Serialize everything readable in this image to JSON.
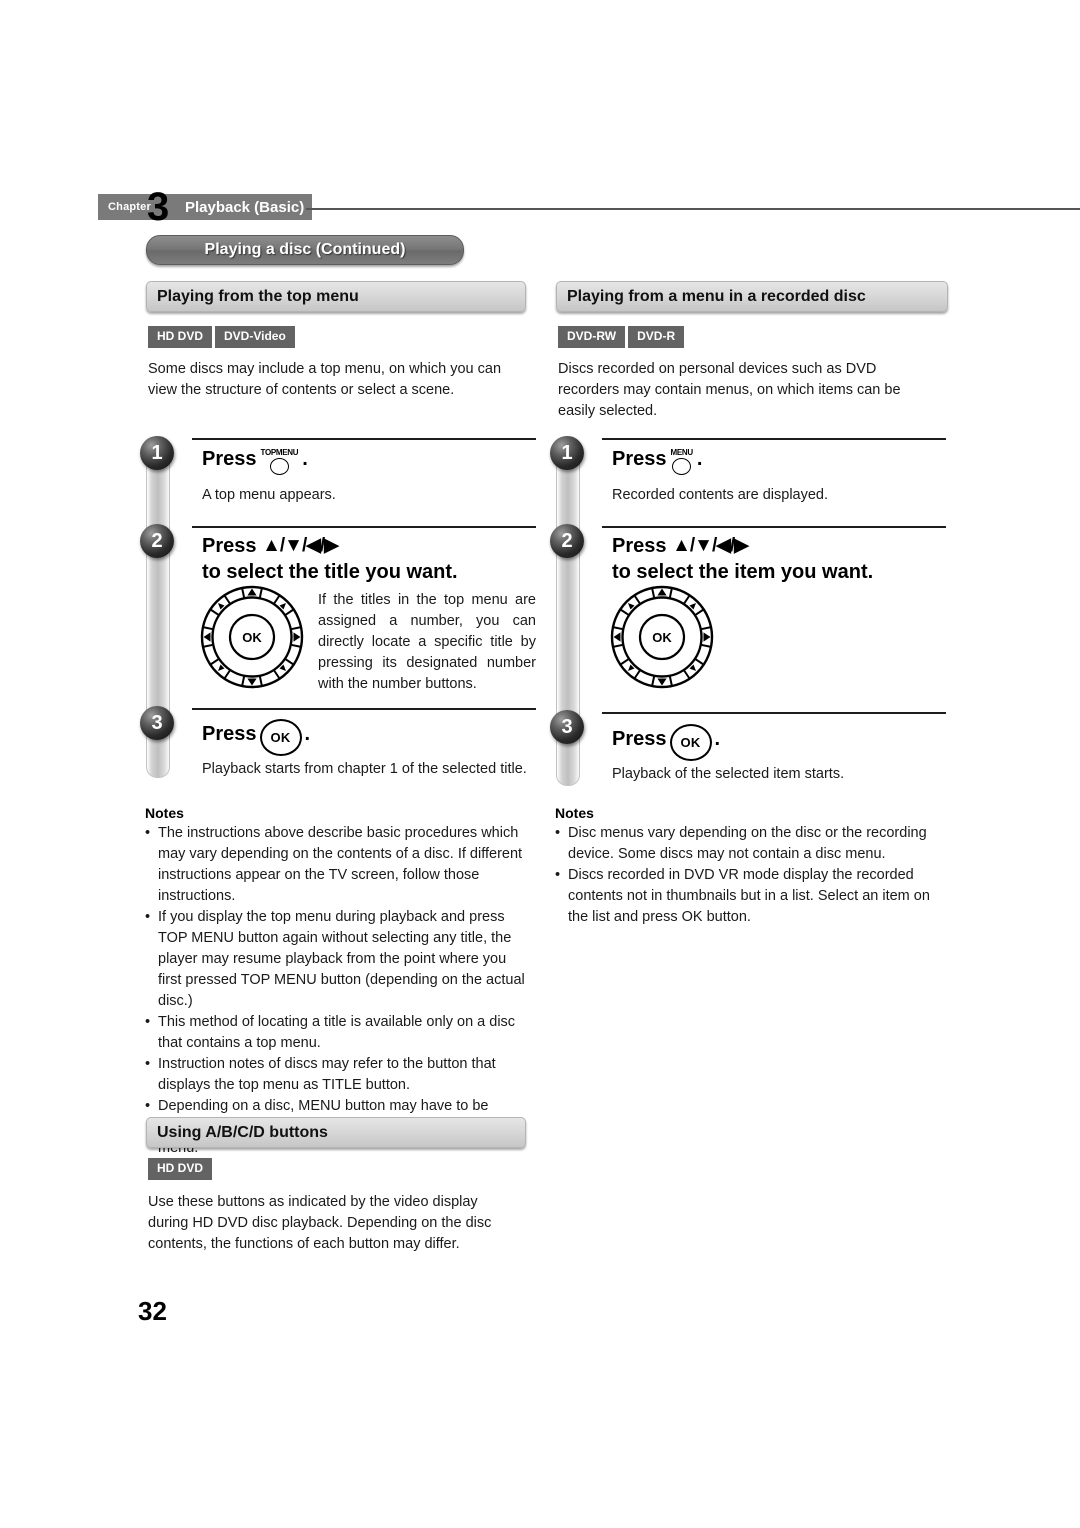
{
  "header": {
    "chapter_word": "Chapter",
    "chapter_number": "3",
    "chapter_title": "Playback (Basic)",
    "banner_title": "Playing a disc (Continued)"
  },
  "page_number": "32",
  "left_column": {
    "section_title": "Playing from the top menu",
    "badges": [
      "HD DVD",
      "DVD-Video"
    ],
    "intro": "Some discs may include a top menu, on which you can view the structure of contents or select a scene.",
    "steps": [
      {
        "number": "1",
        "press_label": "Press",
        "key": "TOPMENU",
        "key_type": "circle-button",
        "period": ".",
        "description": "A top menu appears."
      },
      {
        "number": "2",
        "press_label": "Press",
        "arrows": "▲/▼/◀/▶",
        "title_rest": "to select the title you want.",
        "dpad": true,
        "side_text": "If the titles in the top menu are assigned a number, you can directly locate a specific title by pressing its designated number with the number buttons."
      },
      {
        "number": "3",
        "press_label": "Press",
        "key": "OK",
        "key_type": "ok-button",
        "period": ".",
        "description": "Playback starts from chapter 1 of the selected title."
      }
    ],
    "notes_title": "Notes",
    "notes": [
      "The instructions above describe basic procedures which may vary depending on the contents of a disc. If different instructions appear on the TV screen, follow those instructions.",
      "If you display the top menu during playback and press TOP MENU button again without selecting any title, the player may resume playback from the point where you first pressed TOP MENU button (depending on the actual disc.)",
      "This method of locating a title is available only on a disc that contains a top menu.",
      "Instruction notes of discs may refer to the button that displays the top menu as TITLE button.",
      "Depending on a disc, MENU button may have to be pressed instead of TOP MENU button to display the top menu."
    ],
    "second_section": {
      "section_title": "Using A/B/C/D buttons",
      "badges": [
        "HD DVD"
      ],
      "body": "Use these buttons as indicated by the video display during HD DVD disc playback. Depending on the disc contents, the functions of each button may differ."
    }
  },
  "right_column": {
    "section_title": "Playing from a menu in a recorded disc",
    "badges": [
      "DVD-RW",
      "DVD-R"
    ],
    "intro": "Discs recorded on personal devices such as DVD recorders may contain menus, on which items can be easily selected.",
    "steps": [
      {
        "number": "1",
        "press_label": "Press",
        "key": "MENU",
        "key_type": "circle-button",
        "period": ".",
        "description": "Recorded contents are displayed."
      },
      {
        "number": "2",
        "press_label": "Press",
        "arrows": "▲/▼/◀/▶",
        "title_rest": "to select the item you want.",
        "dpad": true
      },
      {
        "number": "3",
        "press_label": "Press",
        "key": "OK",
        "key_type": "ok-button",
        "period": ".",
        "description": "Playback of the selected item starts."
      }
    ],
    "notes_title": "Notes",
    "notes": [
      "Disc menus vary depending on the disc or the recording device. Some discs may not contain a disc menu.",
      "Discs recorded in DVD VR mode display the recorded contents not in thumbnails but in a list. Select an item on the list and press OK button."
    ]
  },
  "dpad": {
    "center_label": "OK"
  },
  "colors": {
    "badge_bg": "#636363",
    "banner_bg": "#767676",
    "section_bg": "#d7d7d7",
    "rule": "#555555"
  }
}
